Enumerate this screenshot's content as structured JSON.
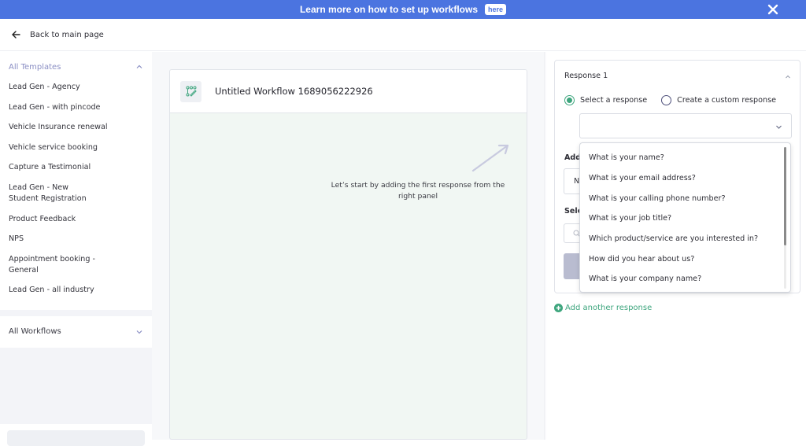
{
  "banner": {
    "text": "Learn more on how to set up workflows",
    "link_label": "here",
    "color": "#4b74e0"
  },
  "topbar": {
    "back_label": "Back to main page"
  },
  "sidebar": {
    "templates_header": "All Templates",
    "templates": [
      "Lead Gen - Agency",
      "Lead Gen - with pincode",
      "Vehicle Insurance renewal",
      "Vehicle service booking",
      "Capture a Testimonial",
      "Lead Gen - New Student Registration",
      "Product Feedback",
      "NPS",
      "Appointment booking - General",
      "Lead Gen - all industry"
    ],
    "workflows_header": "All Workflows"
  },
  "canvas": {
    "workflow_title": "Untitled Workflow 1689056222926",
    "hint": "Let’s start by adding the first response from the right panel"
  },
  "response_panel": {
    "title": "Response 1",
    "radio_options": [
      {
        "label": "Select a response",
        "selected": true
      },
      {
        "label": "Create a custom response",
        "selected": false
      }
    ],
    "select_value": "",
    "add_label_partial": "Add",
    "add_input_partial": "N",
    "select_label_partial": "Sele",
    "dropdown_options": [
      "What is your name?",
      "What is your email address?",
      "What is your calling phone number?",
      "What is your job title?",
      "Which product/service are you interested in?",
      "How did you hear about us?",
      "What is your company name?"
    ],
    "add_another_label": "Add another response",
    "accent_color": "#3da57d"
  }
}
